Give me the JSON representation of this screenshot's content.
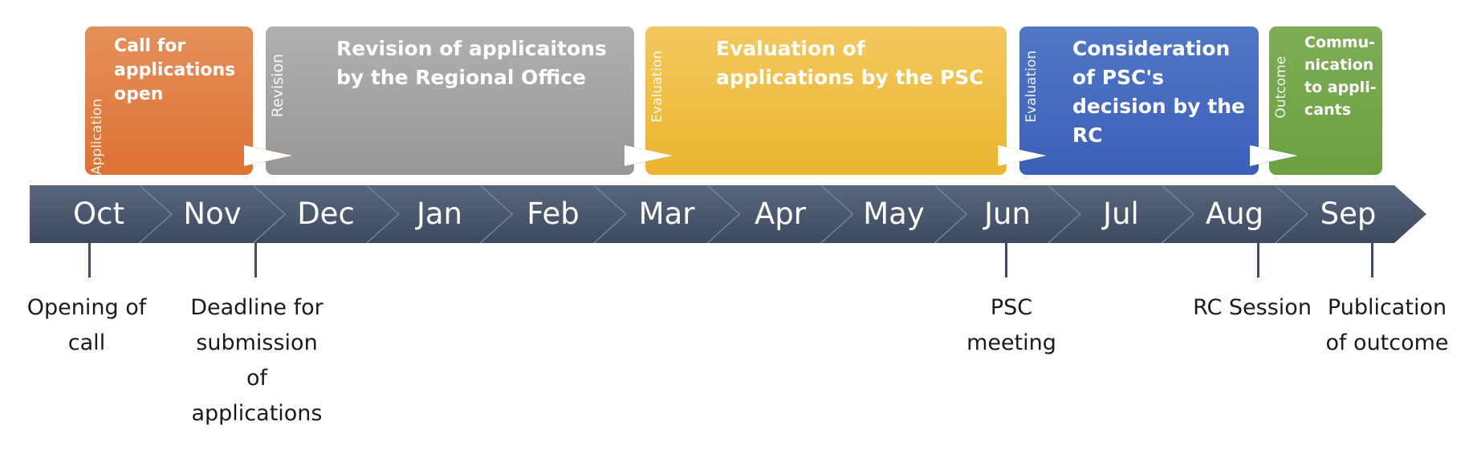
{
  "phases": [
    {
      "category": "Application",
      "title": "Call for applications open",
      "color": "#dd7233"
    },
    {
      "category": "Revision",
      "title": "Revision of applicaitons by the Regional Office",
      "color": "#979797"
    },
    {
      "category": "Evaluation",
      "title": "Evaluation of applications by the PSC",
      "color": "#ebb52c"
    },
    {
      "category": "Evaluation",
      "title": "Consideration of PSC's decision by the RC",
      "color": "#3b60b8"
    },
    {
      "category": "Outcome",
      "title": "Commu-nication to appli-cants",
      "color": "#6ba03f"
    }
  ],
  "timeline": {
    "color": "#3f4c63",
    "months": [
      "Oct",
      "Nov",
      "Dec",
      "Jan",
      "Feb",
      "Mar",
      "Apr",
      "May",
      "Jun",
      "Jul",
      "Aug",
      "Sep"
    ]
  },
  "milestones": [
    {
      "label": "Opening of call",
      "month": "Oct"
    },
    {
      "label": "Deadline for submission of applications",
      "month": "Nov"
    },
    {
      "label": "PSC meeting",
      "month": "Jun"
    },
    {
      "label": "RC Session",
      "month": "Aug"
    },
    {
      "label": "Publication of outcome",
      "month": "Sep"
    }
  ]
}
